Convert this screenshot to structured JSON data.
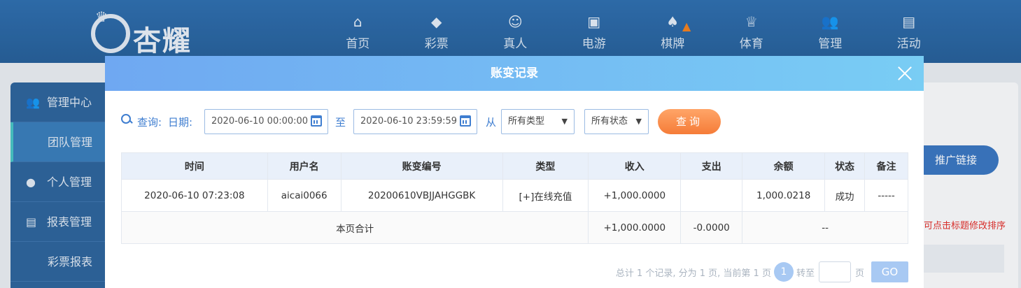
{
  "site": {
    "logo_text": "杏耀",
    "nav": [
      {
        "label": "首页",
        "icon": "home-icon",
        "glyph": "⌂"
      },
      {
        "label": "彩票",
        "icon": "lottery-icon",
        "glyph": "◆"
      },
      {
        "label": "真人",
        "icon": "live-dealer-icon",
        "glyph": "☺"
      },
      {
        "label": "电游",
        "icon": "slot-game-icon",
        "glyph": "▣"
      },
      {
        "label": "棋牌",
        "icon": "card-game-icon",
        "glyph": "♠"
      },
      {
        "label": "体育",
        "icon": "sports-trophy-icon",
        "glyph": "♕"
      },
      {
        "label": "管理",
        "icon": "users-manage-icon",
        "glyph": "👥"
      },
      {
        "label": "活动",
        "icon": "gift-icon",
        "glyph": "▤"
      }
    ]
  },
  "sidebar": {
    "items": [
      {
        "label": "管理中心",
        "icon": "users-icon"
      },
      {
        "label": "团队管理"
      },
      {
        "label": "个人管理",
        "icon": "user-icon"
      },
      {
        "label": "报表管理",
        "icon": "report-icon"
      },
      {
        "label": "彩票报表"
      }
    ]
  },
  "background": {
    "promo_label": "推广链接",
    "sort_hint": "可点击标题修改排序"
  },
  "modal": {
    "title": "账变记录",
    "query_label": "查询:",
    "date_label": "日期:",
    "start_date": "2020-06-10 00:00:00",
    "to_label": "至",
    "end_date": "2020-06-10 23:59:59",
    "from_label": "从",
    "type_select": "所有类型",
    "status_select": "所有状态",
    "query_button": "查询",
    "table": {
      "headers": [
        "时间",
        "用户名",
        "账变编号",
        "类型",
        "收入",
        "支出",
        "余额",
        "状态",
        "备注"
      ],
      "row": {
        "time": "2020-06-10 07:23:08",
        "username": "aicai0066",
        "change_id": "20200610VBJJAHGGBK",
        "type": "[+]在线充值",
        "income": "+1,000.0000",
        "expense": "",
        "balance": "1,000.0218",
        "status": "成功",
        "remark": "-----"
      },
      "summary": {
        "label": "本页合计",
        "income": "+1,000.0000",
        "expense": "-0.0000",
        "balance": "--"
      }
    },
    "pager": {
      "summary": "总计 1 个记录, 分为 1 页, 当前第 1 页",
      "current_page": "1",
      "goto_label": "转至",
      "page_unit": "页",
      "go_button": "GO"
    }
  }
}
